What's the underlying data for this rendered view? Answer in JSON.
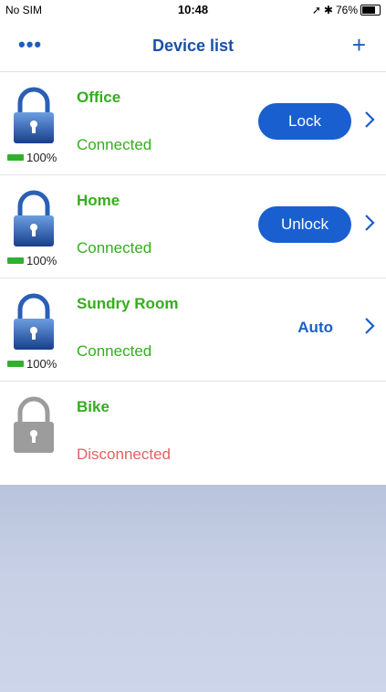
{
  "status_bar": {
    "carrier": "No SIM",
    "time": "10:48",
    "battery_percent": "76%",
    "battery_level": 0.76
  },
  "nav": {
    "title": "Device list",
    "more_label": "•••",
    "add_label": "+"
  },
  "colors": {
    "accent": "#1a5fd0",
    "connected": "#35ad1e",
    "disconnected": "#e46060",
    "lock_active": "#2a5fb5",
    "lock_inactive": "#9c9c9c"
  },
  "devices": [
    {
      "name": "Office",
      "status": "Connected",
      "battery": "100%",
      "action": "Lock",
      "action_style": "button"
    },
    {
      "name": "Home",
      "status": "Connected",
      "battery": "100%",
      "action": "Unlock",
      "action_style": "button"
    },
    {
      "name": "Sundry Room",
      "status": "Connected",
      "battery": "100%",
      "action": "Auto",
      "action_style": "text"
    },
    {
      "name": "Bike",
      "status": "Disconnected",
      "battery": "",
      "action": "",
      "action_style": "none"
    }
  ]
}
